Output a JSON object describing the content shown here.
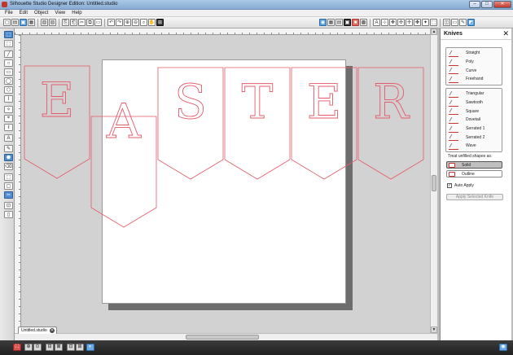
{
  "window": {
    "title": "Silhouette Studio Designer Edition: Untitled.studio",
    "min": "–",
    "max": "□",
    "close": "✕"
  },
  "menu": [
    "File",
    "Edit",
    "Object",
    "View",
    "Help"
  ],
  "toolbar": {
    "left_glyphs": [
      "▢",
      "▤",
      "▣",
      "▦",
      "▧",
      "▨",
      "⎘",
      "⎗",
      "✂",
      "⧉",
      "▭",
      "↶",
      "↷",
      "⊕",
      "⊖",
      "⌕",
      "✋",
      "⊞"
    ],
    "right_glyphs": [
      "◉",
      "▦",
      "▤",
      "▣",
      "■",
      "▩",
      "A",
      "⊹",
      "✥",
      "✣",
      "✢",
      "✤",
      "✦",
      "⬚",
      "◫",
      "▭",
      "✎",
      "◩"
    ]
  },
  "left_tools": [
    "⬚",
    "⬚",
    "╱",
    "○",
    "▭",
    "◯",
    "⬡",
    "⌇",
    "✧",
    "⌖",
    "ℓ",
    "A",
    "✎",
    "⬣",
    "⌫",
    "⬚",
    "▢",
    "✂",
    "⊡",
    "▯"
  ],
  "canvas": {
    "letters": [
      "E",
      "A",
      "S",
      "T",
      "E",
      "R"
    ],
    "cut_line_color": "#e55a6a"
  },
  "document_tab": {
    "label": "Untitled.studio",
    "close": "✕"
  },
  "status_bar": {
    "glyphs": [
      "⛶",
      "⊕",
      "⊙",
      "⊟",
      "⊠",
      "⊡",
      "⊞",
      "◐",
      "◉"
    ]
  },
  "panel": {
    "title": "Knives",
    "close": "✕",
    "knife_group_1": [
      "Straight",
      "Poly",
      "Curve",
      "Freehand"
    ],
    "knife_group_2": [
      "Triangular",
      "Sawtooth",
      "Square",
      "Dovetail",
      "Serrated 1",
      "Serrated 2",
      "Wave"
    ],
    "treat_label": "Treat unfilled shapes as:",
    "options": [
      "Solid",
      "Outline"
    ],
    "selected_option": "Solid",
    "auto_apply_label": "Auto Apply",
    "auto_apply_checked": "✓",
    "apply_button": "Apply Selected Knife"
  }
}
